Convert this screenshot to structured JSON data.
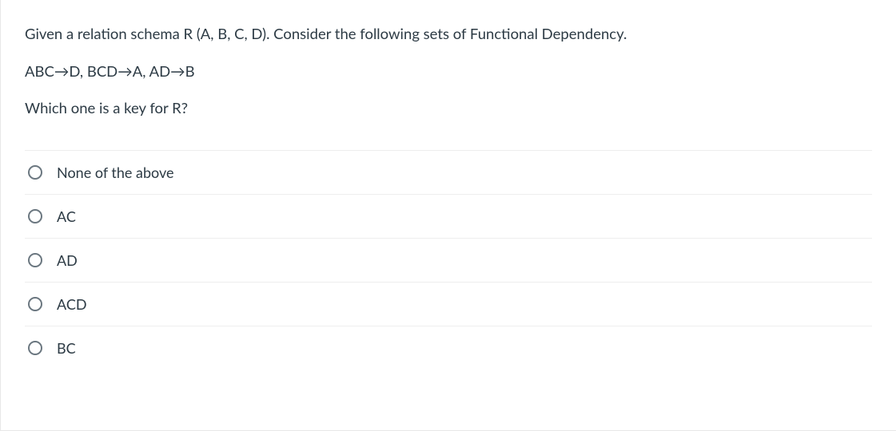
{
  "question": {
    "line1": "Given a relation schema R (A, B, C, D). Consider the following sets of Functional Dependency.",
    "line2": "ABC→D, BCD→A, AD→B",
    "line3": "Which one is a key for R?"
  },
  "options": [
    {
      "label": "None of the above"
    },
    {
      "label": "AC"
    },
    {
      "label": "AD"
    },
    {
      "label": "ACD"
    },
    {
      "label": "BC"
    }
  ]
}
